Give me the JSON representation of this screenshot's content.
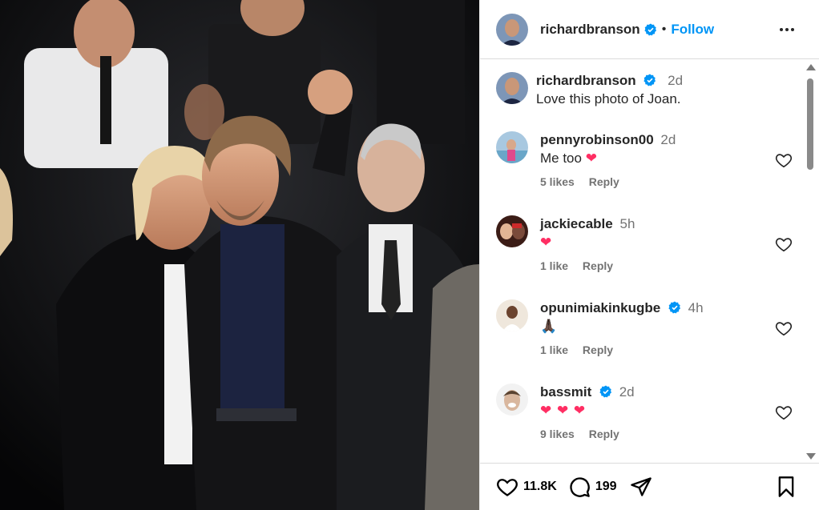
{
  "post": {
    "username": "richardbranson",
    "follow_label": "Follow",
    "caption_time": "2d",
    "caption_text": "Love this photo of Joan."
  },
  "comments": [
    {
      "username": "pennyrobinson00",
      "time": "2d",
      "text": "Me too",
      "emoji": "❤",
      "likes": "5 likes",
      "reply": "Reply",
      "verified": false
    },
    {
      "username": "jackiecable",
      "time": "5h",
      "text": "",
      "emoji": "❤",
      "likes": "1 like",
      "reply": "Reply",
      "verified": false
    },
    {
      "username": "opunimiakinkugbe",
      "time": "4h",
      "text": "",
      "emoji": "🙏🏿",
      "likes": "1 like",
      "reply": "Reply",
      "verified": true
    },
    {
      "username": "bassmit",
      "time": "2d",
      "text": "",
      "emoji": "❤ ❤ ❤",
      "likes": "9 likes",
      "reply": "Reply",
      "verified": true
    }
  ],
  "actions": {
    "likes_count": "11.8K",
    "comments_count": "199"
  },
  "colors": {
    "accent": "#0095f6",
    "verified": "#0095f6",
    "heart_emoji": "#ff2e63"
  }
}
